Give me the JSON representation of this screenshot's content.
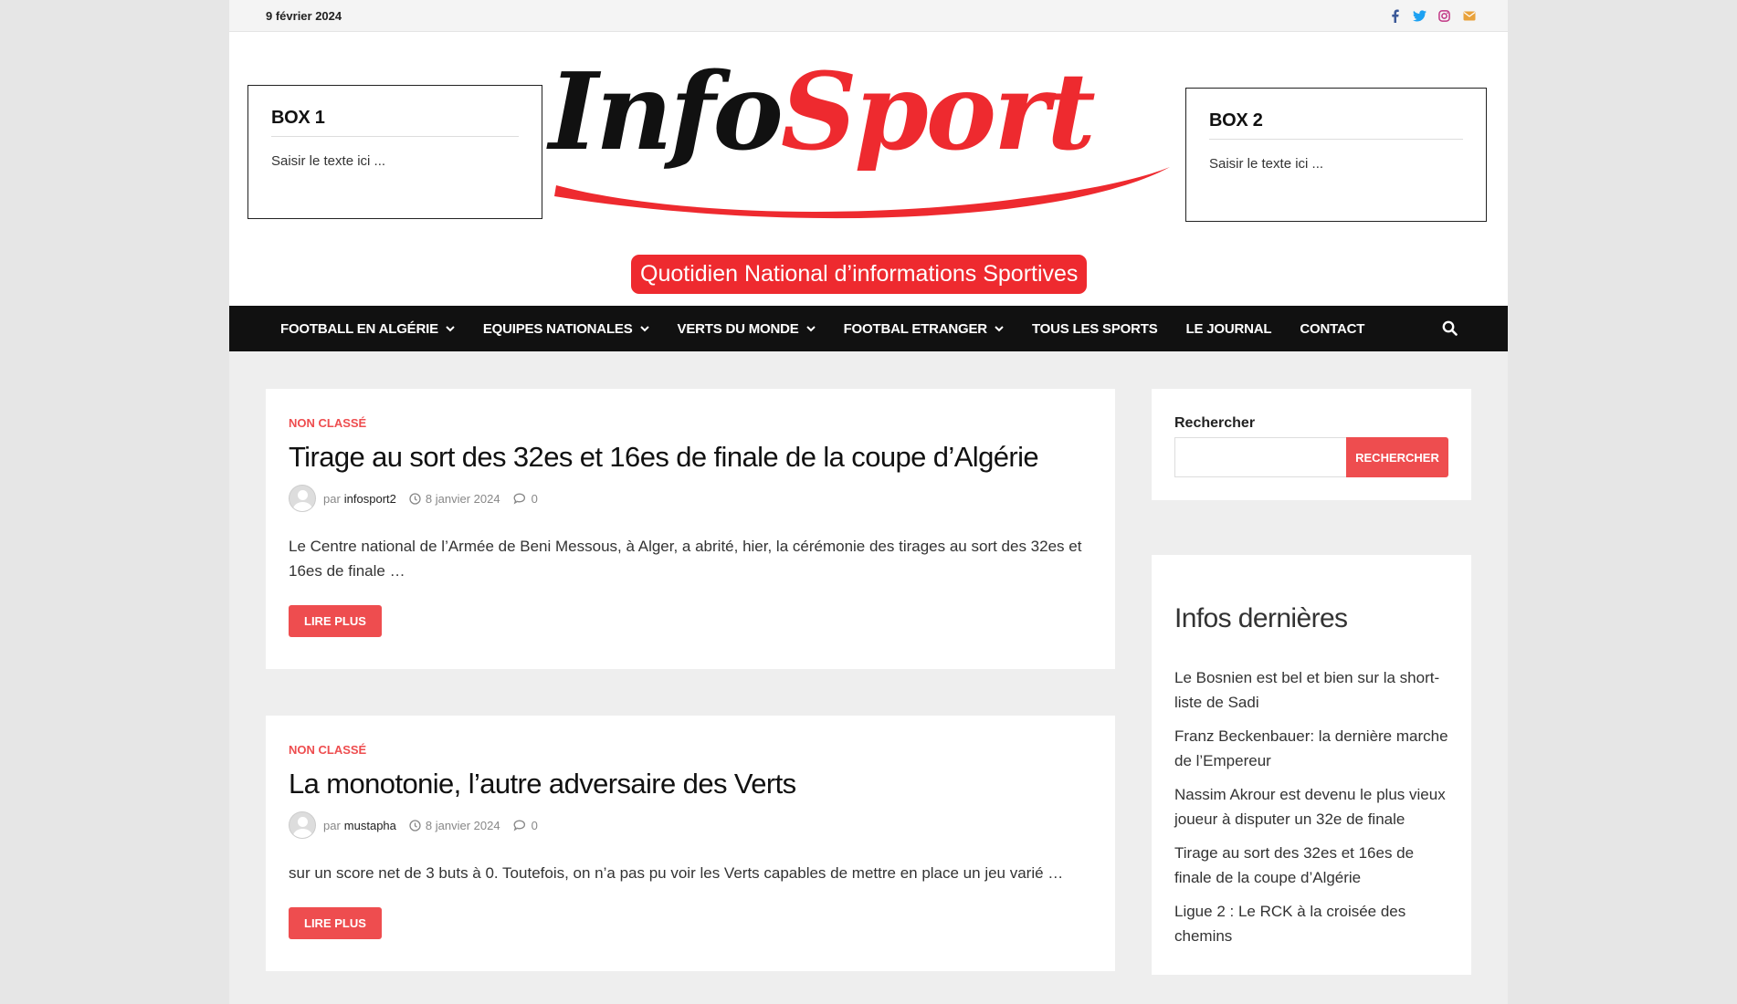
{
  "topbar": {
    "date": "9 février 2024",
    "social": [
      {
        "icon": "facebook-icon",
        "color": "#3b5998"
      },
      {
        "icon": "twitter-icon",
        "color": "#1da1f2"
      },
      {
        "icon": "instagram-icon",
        "color": "#c13584"
      },
      {
        "icon": "mail-icon",
        "color": "#e9a23b"
      }
    ]
  },
  "header": {
    "box1": {
      "title": "BOX 1",
      "text": "Saisir le texte ici ..."
    },
    "box2": {
      "title": "BOX 2",
      "text": "Saisir le texte ici ..."
    },
    "logo": {
      "part1": "Info",
      "part2": "Sport",
      "tagline": "Quotidien National d’informations Sportives"
    },
    "brand_colors": {
      "red": "#ee2a2f",
      "black": "#111111"
    }
  },
  "nav": {
    "items": [
      {
        "label": "FOOTBALL EN ALGÉRIE",
        "dropdown": true
      },
      {
        "label": "EQUIPES NATIONALES",
        "dropdown": true
      },
      {
        "label": "VERTS DU MONDE",
        "dropdown": true
      },
      {
        "label": "FOOTBAL ETRANGER",
        "dropdown": true
      },
      {
        "label": "TOUS LES SPORTS",
        "dropdown": false
      },
      {
        "label": "LE JOURNAL",
        "dropdown": false
      },
      {
        "label": "CONTACT",
        "dropdown": false
      }
    ],
    "search_icon": "search-icon"
  },
  "posts": [
    {
      "category": "NON CLASSÉ",
      "title": "Tirage au sort des 32es et 16es de finale de la coupe d’Algérie",
      "by": "par",
      "author": "infosport2",
      "date": "8 janvier 2024",
      "comments": "0",
      "excerpt": "Le Centre national de l’Armée de Beni Messous, à Alger, a abrité, hier, la cérémonie des tirages au sort des 32es et 16es de finale …",
      "button": "LIRE PLUS"
    },
    {
      "category": "NON CLASSÉ",
      "title": "La monotonie, l’autre adversaire des Verts",
      "by": "par",
      "author": "mustapha",
      "date": "8 janvier 2024",
      "comments": "0",
      "excerpt": "sur un score net de 3 buts à 0. Toutefois, on n’a pas pu voir les Verts capables de mettre en place un jeu varié …",
      "button": "LIRE PLUS"
    }
  ],
  "sidebar": {
    "search": {
      "label": "Rechercher",
      "placeholder": "",
      "button": "RECHERCHER"
    },
    "latest": {
      "title": "Infos dernières",
      "items": [
        "Le Bosnien est bel et bien sur la short-liste de Sadi",
        "Franz Beckenbauer: la dernière marche de l’Empereur",
        "Nassim Akrour est devenu le plus vieux joueur à disputer un 32e de finale",
        "Tirage au sort des 32es et 16es de finale de la coupe d’Algérie",
        "Ligue 2 : Le RCK à la croisée des chemins"
      ]
    }
  },
  "accent_color": "#ee4d4f"
}
